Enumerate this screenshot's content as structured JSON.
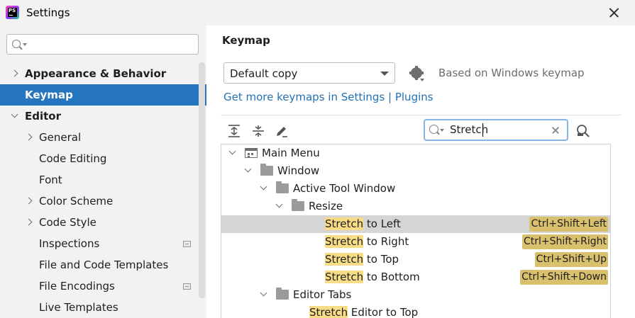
{
  "window": {
    "title": "Settings",
    "app_icon": "phpstorm-logo",
    "app_icon_text": "PS"
  },
  "sidebar": {
    "search": {
      "value": "",
      "placeholder": ""
    },
    "items": [
      {
        "label": "Appearance & Behavior",
        "level": 0,
        "expander": "collapsed",
        "bold": true
      },
      {
        "label": "Keymap",
        "level": 0,
        "expander": "none",
        "bold": true,
        "selected": true
      },
      {
        "label": "Editor",
        "level": 0,
        "expander": "expanded",
        "bold": true
      },
      {
        "label": "General",
        "level": 1,
        "expander": "collapsed"
      },
      {
        "label": "Code Editing",
        "level": 1,
        "expander": "none"
      },
      {
        "label": "Font",
        "level": 1,
        "expander": "none"
      },
      {
        "label": "Color Scheme",
        "level": 1,
        "expander": "collapsed"
      },
      {
        "label": "Code Style",
        "level": 1,
        "expander": "collapsed"
      },
      {
        "label": "Inspections",
        "level": 1,
        "expander": "none",
        "badge": "project-settings-icon"
      },
      {
        "label": "File and Code Templates",
        "level": 1,
        "expander": "none"
      },
      {
        "label": "File Encodings",
        "level": 1,
        "expander": "none",
        "badge": "project-settings-icon"
      },
      {
        "label": "Live Templates",
        "level": 1,
        "expander": "none"
      }
    ]
  },
  "main": {
    "title": "Keymap",
    "keymap_select": {
      "value": "Default copy"
    },
    "based_on": "Based on Windows keymap",
    "get_more_link": "Get more keymaps in Settings | Plugins",
    "toolbar": {
      "expand_all": "expand-all-icon",
      "collapse_all": "collapse-all-icon",
      "edit": "edit-pen-icon",
      "find_by_shortcut": "find-by-shortcut-icon"
    },
    "filter": {
      "value": "Stretch"
    },
    "tree": [
      {
        "label": "Main Menu",
        "icon": "menu",
        "level": 0,
        "expander": "expanded"
      },
      {
        "label": "Window",
        "icon": "folder",
        "level": 1,
        "expander": "expanded"
      },
      {
        "label": "Active Tool Window",
        "icon": "folder",
        "level": 2,
        "expander": "expanded"
      },
      {
        "label": "Resize",
        "icon": "folder",
        "level": 3,
        "expander": "expanded"
      },
      {
        "highlight": "Stretch",
        "rest": " to Left",
        "level": 4,
        "shortcut": "Ctrl+Shift+Left",
        "selected": true
      },
      {
        "highlight": "Stretch",
        "rest": " to Right",
        "level": 4,
        "shortcut": "Ctrl+Shift+Right"
      },
      {
        "highlight": "Stretch",
        "rest": " to Top",
        "level": 4,
        "shortcut": "Ctrl+Shift+Up"
      },
      {
        "highlight": "Stretch",
        "rest": " to Bottom",
        "level": 4,
        "shortcut": "Ctrl+Shift+Down"
      },
      {
        "label": "Editor Tabs",
        "icon": "folder",
        "level": 2,
        "expander": "expanded"
      },
      {
        "highlight": "Stretch",
        "rest": " Editor to Top",
        "level": 3
      }
    ],
    "colors": {
      "selection": "#2675bf",
      "match_highlight": "#f8dd86",
      "shortcut_bg": "#d9c06d",
      "link": "#2470b3"
    }
  }
}
